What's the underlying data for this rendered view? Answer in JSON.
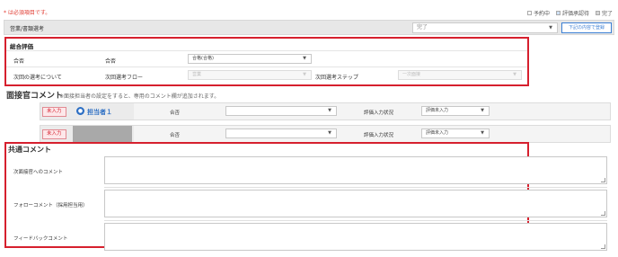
{
  "required_note": "* は必須項目です。",
  "legend": [
    {
      "label": "予約中",
      "color": "#ffffff"
    },
    {
      "label": "評価承認待",
      "color": "#cfe0f4"
    },
    {
      "label": "完了",
      "color": "#d5d5d5"
    }
  ],
  "stage": {
    "label": "営業/書類選考",
    "status_value": "完了",
    "register_button": "下記の内容で登録"
  },
  "overall": {
    "title": "総合評価",
    "result_row_label": "合否",
    "result_field_label": "合否",
    "result_value": "合格(合格)",
    "next_row_label": "次回の選考について",
    "next_flow_label": "次回選考フロー",
    "next_flow_value": "営業",
    "next_step_label": "次回選考ステップ",
    "next_step_value": "一次面接"
  },
  "interviewer": {
    "title": "面接官コメント",
    "note": "※面接担当者の設定をすると、専用のコメント欄が追加されます。",
    "rows": [
      {
        "badge": "未入力",
        "name": "担当者１",
        "result_label": "合否",
        "result_value": "",
        "eval_label": "評価入力状況",
        "eval_value": "評価未入力"
      },
      {
        "badge": "未入力",
        "name": "",
        "result_label": "合否",
        "result_value": "",
        "eval_label": "評価入力状況",
        "eval_value": "評価未入力"
      }
    ]
  },
  "common": {
    "title": "共通コメント",
    "fields": [
      {
        "label": "次面接官へのコメント",
        "value": ""
      },
      {
        "label": "フォローコメント（採用担当用）",
        "value": ""
      },
      {
        "label": "フィードバックコメント",
        "value": ""
      }
    ]
  },
  "colors": {
    "highlight_border": "#d6202e",
    "accent_blue": "#2d6fc4",
    "required_red": "#e0392f"
  }
}
